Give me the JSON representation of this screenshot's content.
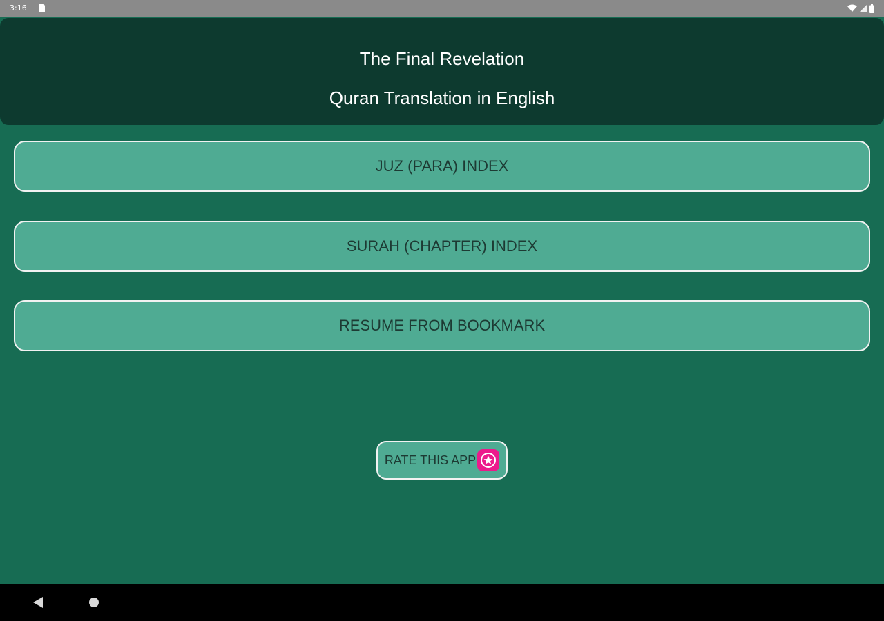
{
  "status_bar": {
    "time": "3:16"
  },
  "header": {
    "title": "The Final Revelation",
    "subtitle": "Quran Translation in English",
    "background": "#0d3a2f"
  },
  "menu": {
    "juz_index_label": "JUZ (PARA) INDEX",
    "surah_index_label": "SURAH (CHAPTER) INDEX",
    "resume_label": "RESUME FROM BOOKMARK",
    "button_color": "#4fab93"
  },
  "rate": {
    "label": "RATE THIS APP",
    "icon": "star-icon",
    "icon_color": "#ec1a8c"
  },
  "theme": {
    "background": "#176c53"
  },
  "nav_bar": {
    "back_icon": "back-triangle-icon",
    "home_icon": "home-circle-icon"
  }
}
